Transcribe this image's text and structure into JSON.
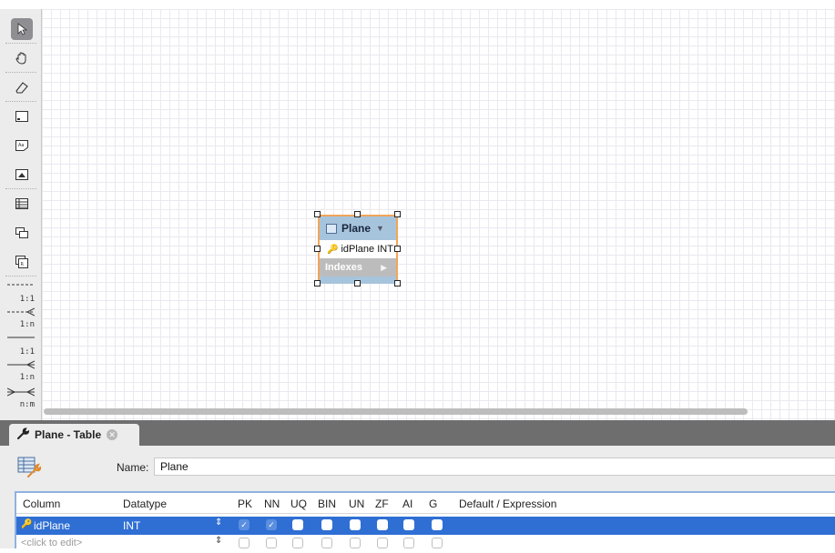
{
  "palette": {
    "relations": [
      {
        "name": "relation-1-1-non-identifying",
        "label": "1:1"
      },
      {
        "name": "relation-1-n-non-identifying",
        "label": "1:n"
      },
      {
        "name": "relation-1-1-identifying",
        "label": "1:1"
      },
      {
        "name": "relation-1-n-identifying",
        "label": "1:n"
      },
      {
        "name": "relation-n-m",
        "label": "n:m"
      }
    ]
  },
  "diagram": {
    "table_name": "Plane",
    "column": "idPlane INT",
    "indexes_label": "Indexes"
  },
  "tab": {
    "title": "Plane - Table"
  },
  "editor": {
    "name_label": "Name:",
    "name_value": "Plane",
    "columns_header": {
      "column": "Column",
      "datatype": "Datatype",
      "flags": [
        "PK",
        "NN",
        "UQ",
        "BIN",
        "UN",
        "ZF",
        "AI",
        "G"
      ],
      "default": "Default / Expression"
    },
    "rows": [
      {
        "column": "idPlane",
        "datatype": "INT",
        "PK": true,
        "NN": true,
        "UQ": false,
        "BIN": false,
        "UN": false,
        "ZF": false,
        "AI": false,
        "G": false,
        "default": ""
      }
    ],
    "new_row_placeholder": "<click to edit>"
  },
  "colors": {
    "selection": "#2f6fd4",
    "table_header": "#a7c4dd",
    "selected_border": "#f2a55a",
    "tab_bar": "#6e6e6e"
  }
}
